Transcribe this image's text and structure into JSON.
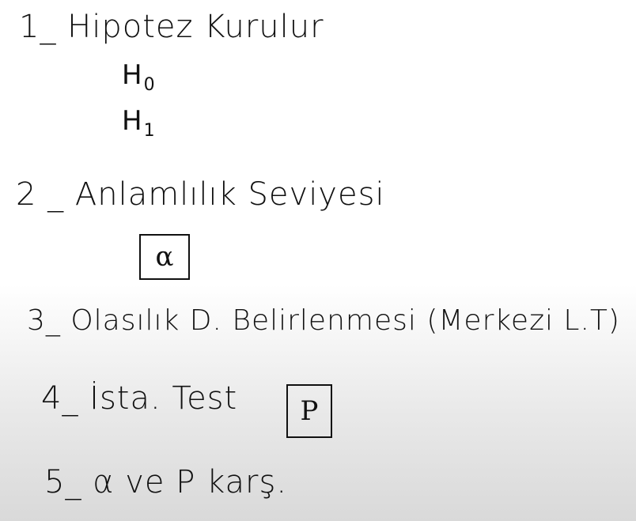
{
  "steps": [
    {
      "label": "1_ Hipotez Kurulur"
    },
    {
      "label": "2 _ Anlamlılık Seviyesi"
    },
    {
      "label": "3_ Olasılık D. Belirlenmesi (Merkezi L.T)"
    },
    {
      "label": "4_ İsta. Test"
    },
    {
      "label": "5_ α ve P karş."
    }
  ],
  "hypotheses": {
    "h0": {
      "letter": "H",
      "index": "0"
    },
    "h1": {
      "letter": "H",
      "index": "1"
    }
  },
  "boxes": {
    "alpha": "α",
    "p": "P"
  },
  "colors": {
    "ink": "#111111",
    "background_top": "#ffffff",
    "background_bottom": "#d9d9d9"
  }
}
